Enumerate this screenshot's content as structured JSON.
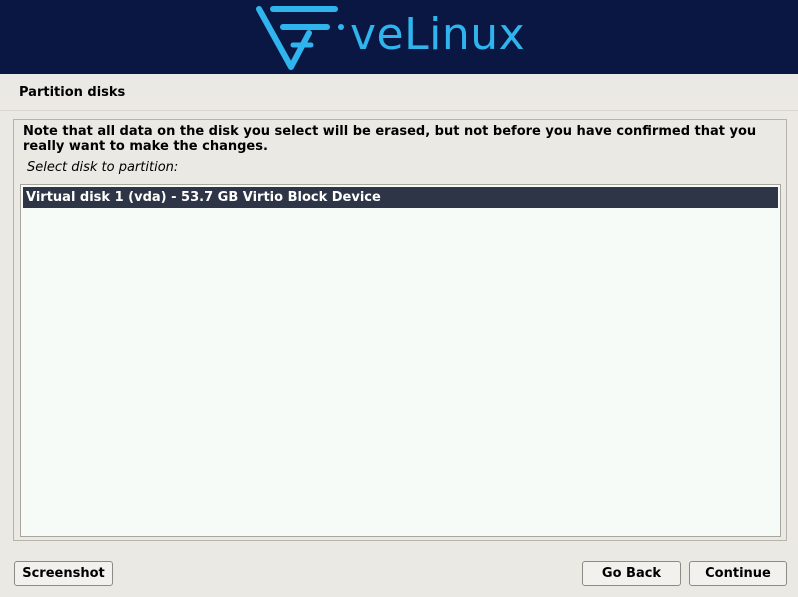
{
  "header": {
    "logo_text": "veLinux",
    "accent_color": "#2fb4ee",
    "background_color": "#0b1743"
  },
  "page": {
    "title": "Partition disks",
    "note": "Note that all data on the disk you select will be erased, but not before you have confirmed that you really want to make the changes.",
    "prompt": "Select disk to partition:"
  },
  "disks": [
    {
      "label": "Virtual disk 1 (vda) - 53.7 GB Virtio Block Device",
      "selected": true
    }
  ],
  "buttons": {
    "screenshot": "Screenshot",
    "go_back": "Go Back",
    "continue": "Continue"
  }
}
